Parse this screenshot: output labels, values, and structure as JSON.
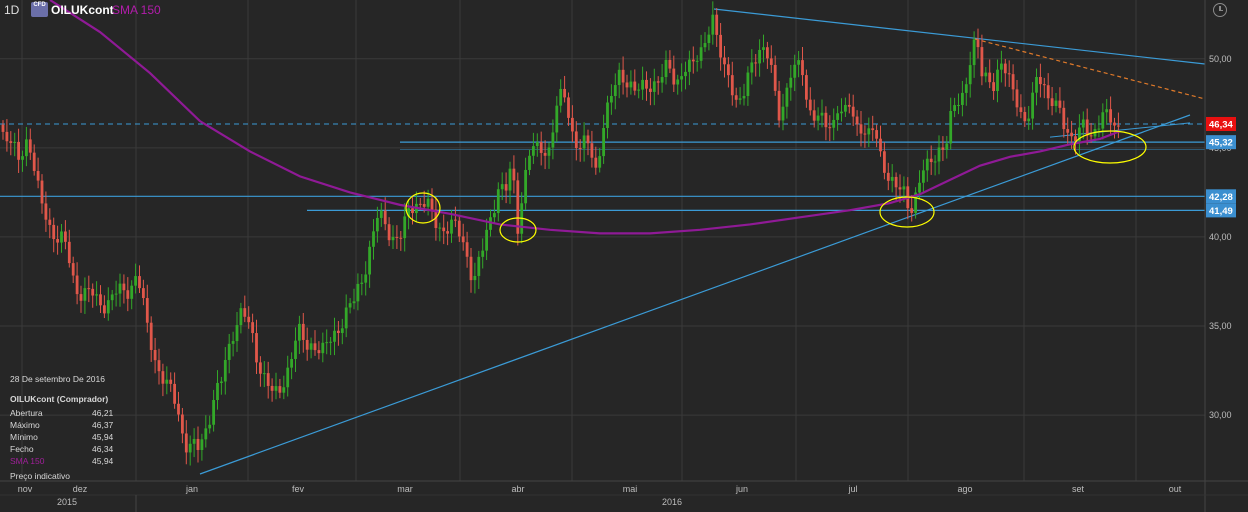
{
  "header": {
    "timeframe": "1D",
    "logo_text": "CFD",
    "symbol": "OILUKcont",
    "indicator": "SMA 150"
  },
  "colors": {
    "background": "#262626",
    "bull": "#33a829",
    "bear": "#e0574a",
    "sma": "#8f1a96",
    "trendline": "#3b9bd6",
    "orange": "#e07a2a",
    "circle": "#ffff00",
    "price_badge": "#e81010",
    "level_badge": "#3b8fd0"
  },
  "info_panel": {
    "date": "28 De setembro De 2016",
    "instrument": "OILUKcont (Comprador)",
    "rows": [
      {
        "label": "Abertura",
        "value": "46,21"
      },
      {
        "label": "Máximo",
        "value": "46,37"
      },
      {
        "label": "Mínimo",
        "value": "45,94"
      },
      {
        "label": "Fecho",
        "value": "46,34"
      },
      {
        "label": "SMA 150",
        "value": "45,94"
      }
    ],
    "note": "Preço indicativo"
  },
  "chart_data": {
    "type": "candlestick",
    "title": "OILUKcont",
    "x_tick_labels": [
      "nov",
      "dez",
      "jan",
      "fev",
      "mar",
      "abr",
      "mai",
      "jun",
      "jul",
      "ago",
      "set",
      "out"
    ],
    "year_labels": [
      "2015",
      "2016"
    ],
    "y_tick_labels": [
      "30,00",
      "35,00",
      "40,00",
      "45,00",
      "50,00"
    ],
    "y_ticks": [
      30,
      35,
      40,
      45,
      50
    ],
    "ylim": [
      26.3,
      53.3
    ],
    "price_markers": [
      {
        "label": "46,34",
        "value": 46.34,
        "kind": "last"
      },
      {
        "label": "45,32",
        "value": 45.32,
        "kind": "level"
      },
      {
        "label": "42,28",
        "value": 42.28,
        "kind": "level"
      },
      {
        "label": "41,49",
        "value": 41.49,
        "kind": "level"
      }
    ],
    "sma_label": "SMA 150",
    "close_path": [
      [
        0,
        46.3
      ],
      [
        9,
        45.3
      ],
      [
        18,
        44.2
      ],
      [
        28,
        45.9
      ],
      [
        40,
        41.8
      ],
      [
        52,
        40.5
      ],
      [
        64,
        39.6
      ],
      [
        75,
        37.3
      ],
      [
        85,
        36.9
      ],
      [
        98,
        36.3
      ],
      [
        112,
        36.6
      ],
      [
        125,
        36.9
      ],
      [
        137,
        38.0
      ],
      [
        147,
        34.8
      ],
      [
        157,
        33.0
      ],
      [
        167,
        31.5
      ],
      [
        177,
        30.5
      ],
      [
        185,
        28.6
      ],
      [
        192,
        28.1
      ],
      [
        199,
        27.9
      ],
      [
        207,
        29.6
      ],
      [
        214,
        31.1
      ],
      [
        221,
        31.6
      ],
      [
        228,
        33.5
      ],
      [
        235,
        35.3
      ],
      [
        242,
        35.9
      ],
      [
        250,
        34.6
      ],
      [
        258,
        33.1
      ],
      [
        266,
        32.2
      ],
      [
        274,
        30.7
      ],
      [
        282,
        31.6
      ],
      [
        290,
        33.3
      ],
      [
        298,
        34.5
      ],
      [
        306,
        33.8
      ],
      [
        314,
        34.3
      ],
      [
        322,
        33.4
      ],
      [
        330,
        34.0
      ],
      [
        338,
        35.1
      ],
      [
        346,
        35.7
      ],
      [
        354,
        36.2
      ],
      [
        362,
        37.8
      ],
      [
        370,
        39.5
      ],
      [
        378,
        41.0
      ],
      [
        386,
        40.7
      ],
      [
        394,
        40.1
      ],
      [
        402,
        39.9
      ],
      [
        410,
        41.6
      ],
      [
        418,
        42.2
      ],
      [
        426,
        41.9
      ],
      [
        434,
        40.7
      ],
      [
        442,
        40.6
      ],
      [
        450,
        40.8
      ],
      [
        458,
        40.1
      ],
      [
        466,
        39.3
      ],
      [
        474,
        37.7
      ],
      [
        482,
        38.9
      ],
      [
        490,
        40.9
      ],
      [
        498,
        43.0
      ],
      [
        506,
        42.5
      ],
      [
        512,
        43.8
      ],
      [
        518,
        40.6
      ],
      [
        524,
        43.4
      ],
      [
        530,
        44.8
      ],
      [
        536,
        44.6
      ],
      [
        542,
        45.0
      ],
      [
        548,
        44.9
      ],
      [
        556,
        47.1
      ],
      [
        564,
        47.9
      ],
      [
        572,
        46.1
      ],
      [
        580,
        45.1
      ],
      [
        588,
        45.0
      ],
      [
        596,
        43.8
      ],
      [
        604,
        46.7
      ],
      [
        612,
        47.7
      ],
      [
        620,
        49.2
      ],
      [
        628,
        49.0
      ],
      [
        636,
        47.9
      ],
      [
        644,
        48.3
      ],
      [
        652,
        48.9
      ],
      [
        660,
        48.7
      ],
      [
        668,
        49.4
      ],
      [
        676,
        48.9
      ],
      [
        684,
        49.5
      ],
      [
        692,
        49.2
      ],
      [
        700,
        50.6
      ],
      [
        706,
        51.4
      ],
      [
        712,
        52.3
      ],
      [
        718,
        50.4
      ],
      [
        724,
        49.6
      ],
      [
        730,
        49.3
      ],
      [
        736,
        47.6
      ],
      [
        742,
        47.2
      ],
      [
        748,
        48.9
      ],
      [
        754,
        50.4
      ],
      [
        760,
        50.7
      ],
      [
        766,
        50.2
      ],
      [
        772,
        49.0
      ],
      [
        778,
        47.0
      ],
      [
        784,
        47.8
      ],
      [
        790,
        49.0
      ],
      [
        796,
        49.2
      ],
      [
        802,
        49.6
      ],
      [
        808,
        47.5
      ],
      [
        814,
        46.9
      ],
      [
        820,
        46.3
      ],
      [
        826,
        46.2
      ],
      [
        832,
        46.4
      ],
      [
        838,
        47.6
      ],
      [
        844,
        46.6
      ],
      [
        850,
        47.2
      ],
      [
        856,
        46.3
      ],
      [
        862,
        46.5
      ],
      [
        868,
        45.6
      ],
      [
        874,
        45.8
      ],
      [
        880,
        44.6
      ],
      [
        886,
        44.0
      ],
      [
        892,
        43.2
      ],
      [
        898,
        42.4
      ],
      [
        904,
        42.3
      ],
      [
        910,
        41.7
      ],
      [
        916,
        42.6
      ],
      [
        922,
        43.5
      ],
      [
        928,
        43.7
      ],
      [
        934,
        44.6
      ],
      [
        940,
        45.3
      ],
      [
        946,
        45.1
      ],
      [
        952,
        46.7
      ],
      [
        958,
        47.6
      ],
      [
        964,
        48.4
      ],
      [
        970,
        50.0
      ],
      [
        976,
        50.8
      ],
      [
        982,
        49.0
      ],
      [
        988,
        49.2
      ],
      [
        994,
        48.8
      ],
      [
        1000,
        49.4
      ],
      [
        1006,
        49.0
      ],
      [
        1012,
        48.6
      ],
      [
        1018,
        47.9
      ],
      [
        1024,
        46.2
      ],
      [
        1030,
        46.6
      ],
      [
        1036,
        48.8
      ],
      [
        1042,
        49.4
      ],
      [
        1048,
        47.8
      ],
      [
        1054,
        47.2
      ],
      [
        1060,
        46.8
      ],
      [
        1066,
        46.3
      ],
      [
        1072,
        45.8
      ],
      [
        1078,
        45.6
      ],
      [
        1084,
        46.0
      ],
      [
        1090,
        45.7
      ],
      [
        1096,
        46.4
      ],
      [
        1102,
        46.9
      ],
      [
        1108,
        46.4
      ],
      [
        1114,
        46.2
      ],
      [
        1120,
        46.34
      ]
    ],
    "sma_path": [
      [
        50,
        53.3
      ],
      [
        100,
        51.5
      ],
      [
        150,
        49.2
      ],
      [
        200,
        46.5
      ],
      [
        250,
        44.8
      ],
      [
        300,
        43.4
      ],
      [
        350,
        42.5
      ],
      [
        400,
        41.8
      ],
      [
        450,
        41.3
      ],
      [
        500,
        40.7
      ],
      [
        550,
        40.4
      ],
      [
        600,
        40.2
      ],
      [
        650,
        40.2
      ],
      [
        700,
        40.4
      ],
      [
        750,
        40.7
      ],
      [
        800,
        41.1
      ],
      [
        850,
        41.5
      ],
      [
        890,
        41.9
      ],
      [
        920,
        42.4
      ],
      [
        950,
        43.2
      ],
      [
        980,
        44.0
      ],
      [
        1010,
        44.5
      ],
      [
        1040,
        44.8
      ],
      [
        1070,
        45.2
      ],
      [
        1100,
        45.5
      ],
      [
        1120,
        45.94
      ]
    ]
  }
}
